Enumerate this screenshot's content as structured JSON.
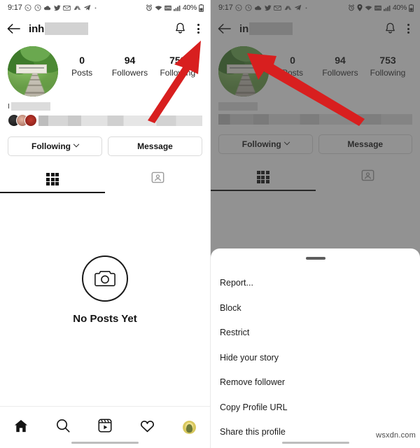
{
  "screens": [
    {
      "id": "profile-screen",
      "status_bar": {
        "time": "9:17",
        "battery": "40%",
        "left_icons": [
          "whatsapp-icon",
          "clock-icon",
          "cloud-icon",
          "twitter-icon",
          "gmail-icon",
          "drive-icon",
          "telegram-icon",
          "dot-icon"
        ],
        "right_icons": [
          "alarm-icon",
          "wifi-icon",
          "signal-vpn-icon",
          "signal-bars-icon",
          "battery-icon"
        ]
      },
      "app_bar": {
        "back_icon": "arrow-left-icon",
        "username": "inh",
        "username_redacted": true,
        "notify_icon": "bell-icon",
        "more_icon": "three-dots-icon"
      },
      "profile": {
        "avatar": "profile-photo",
        "stats": [
          {
            "num": "0",
            "label": "Posts"
          },
          {
            "num": "94",
            "label": "Followers"
          },
          {
            "num": "753",
            "label": "Following"
          }
        ],
        "bio_redacted": true,
        "mutuals_redacted": true
      },
      "actions": [
        {
          "label": "Following",
          "has_chevron": true
        },
        {
          "label": "Message",
          "has_chevron": false
        }
      ],
      "tabs": [
        {
          "icon": "grid-icon",
          "active": true
        },
        {
          "icon": "tagged-person-icon",
          "active": false
        }
      ],
      "empty_state": {
        "icon": "camera-icon",
        "text": "No Posts Yet"
      },
      "bottom_nav": [
        {
          "icon": "home-icon"
        },
        {
          "icon": "search-icon"
        },
        {
          "icon": "reels-icon"
        },
        {
          "icon": "heart-icon"
        },
        {
          "icon": "profile-avatar-icon"
        }
      ],
      "annotation": {
        "arrow": "red-arrow-to-three-dots",
        "points_to": "three-dots-icon"
      }
    },
    {
      "id": "options-sheet-screen",
      "status_bar": {
        "time": "9:17",
        "battery": "40%",
        "left_icons": [
          "whatsapp-icon",
          "clock-icon",
          "cloud-icon",
          "twitter-icon",
          "gmail-icon",
          "drive-icon",
          "telegram-icon",
          "dot-icon"
        ],
        "right_icons": [
          "alarm-icon",
          "location-icon",
          "wifi-icon",
          "signal-vpn-icon",
          "signal-bars-icon",
          "battery-icon"
        ]
      },
      "app_bar": {
        "back_icon": "arrow-left-icon",
        "username": "in",
        "username_redacted": true,
        "notify_icon": "bell-icon",
        "more_icon": "three-dots-icon"
      },
      "profile": {
        "avatar": "profile-photo",
        "stats": [
          {
            "num": "0",
            "label": "Posts"
          },
          {
            "num": "94",
            "label": "Followers"
          },
          {
            "num": "753",
            "label": "Following"
          }
        ],
        "bio_redacted": true,
        "mutuals_redacted": true
      },
      "actions": [
        {
          "label": "Following",
          "has_chevron": true
        },
        {
          "label": "Message",
          "has_chevron": false
        }
      ],
      "tabs": [
        {
          "icon": "grid-icon",
          "active": true
        },
        {
          "icon": "tagged-person-icon",
          "active": false
        }
      ],
      "sheet": {
        "handle": "drag-handle",
        "items": [
          "Report...",
          "Block",
          "Restrict",
          "Hide your story",
          "Remove follower",
          "Copy Profile URL",
          "Share this profile"
        ]
      },
      "annotation": {
        "arrow": "red-arrow-to-block",
        "points_to": "Block"
      }
    }
  ],
  "watermark": "wsxdn.com",
  "colors": {
    "accent_arrow": "#d81f1f",
    "scrim": "#7a7a7a",
    "text_primary": "#141414",
    "text_secondary": "#2b2b2b",
    "border": "#dadada"
  }
}
